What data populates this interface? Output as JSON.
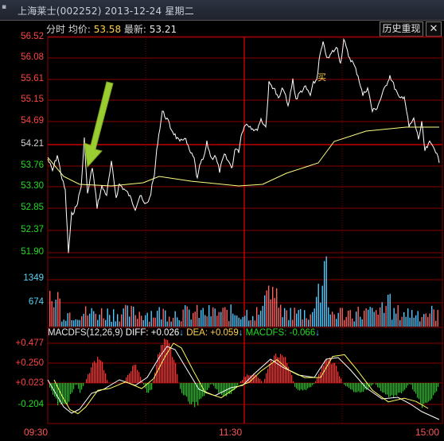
{
  "window": {
    "title": "上海莱士(002252) 2013-12-24 星期二",
    "toggle_glyph": "▪"
  },
  "header": {
    "mode_label": "分时",
    "avg_label": "均价:",
    "avg_value": "53.58",
    "last_label": "最新:",
    "last_value": "53.21"
  },
  "buttons": {
    "history_label": "历史重现",
    "close_label": "✕"
  },
  "price_axis": [
    {
      "label": "56.52",
      "tone": "red"
    },
    {
      "label": "56.08",
      "tone": "red"
    },
    {
      "label": "55.61",
      "tone": "red"
    },
    {
      "label": "55.15",
      "tone": "red"
    },
    {
      "label": "54.69",
      "tone": "red"
    },
    {
      "label": "54.21",
      "tone": "white"
    },
    {
      "label": "53.76",
      "tone": "green"
    },
    {
      "label": "53.30",
      "tone": "green"
    },
    {
      "label": "52.85",
      "tone": "green"
    },
    {
      "label": "52.37",
      "tone": "green"
    },
    {
      "label": "51.90",
      "tone": "green"
    }
  ],
  "volume_axis": [
    "1349",
    "674"
  ],
  "macd_axis": [
    {
      "label": "+0.477",
      "tone": "red"
    },
    {
      "label": "+0.250",
      "tone": "red"
    },
    {
      "label": "+0.023",
      "tone": "red"
    },
    {
      "label": "-0.204",
      "tone": "green"
    }
  ],
  "macd_legend": {
    "name": "MACDFS(12,26,9)",
    "diff_label": "DIFF: +0.026",
    "dea_label": "DEA: +0.059",
    "dfs_label": "MACDFS: -0.066",
    "arrow": "↓"
  },
  "time_axis": [
    "09:30",
    "11:30",
    "15:00"
  ],
  "annotation": {
    "label": "买"
  },
  "colors": {
    "price_line": "#ffffff",
    "avg_line": "#ffff80",
    "grid_red": "#8a0000",
    "volume_up": "#ff6060",
    "volume_down": "#50c8ff",
    "macd_pos": "#ff3030",
    "macd_neg": "#20c020",
    "arrow": "#9acd32"
  }
}
